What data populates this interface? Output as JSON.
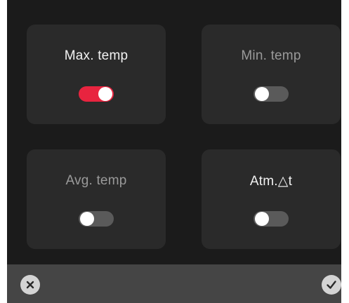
{
  "tiles": [
    {
      "label": "Max. temp",
      "enabled": true
    },
    {
      "label": "Min. temp",
      "enabled": false
    },
    {
      "label": "Avg. temp",
      "enabled": false
    },
    {
      "label": "Atm.△t",
      "enabled": false
    }
  ],
  "footer": {
    "cancel_icon": "close-icon",
    "confirm_icon": "check-icon"
  },
  "colors": {
    "screen_bg": "#1b1b1b",
    "tile_bg": "#2a2a2a",
    "toggle_on": "#e8243f",
    "toggle_off": "#5a5a5a",
    "bar_bg": "#454545"
  }
}
